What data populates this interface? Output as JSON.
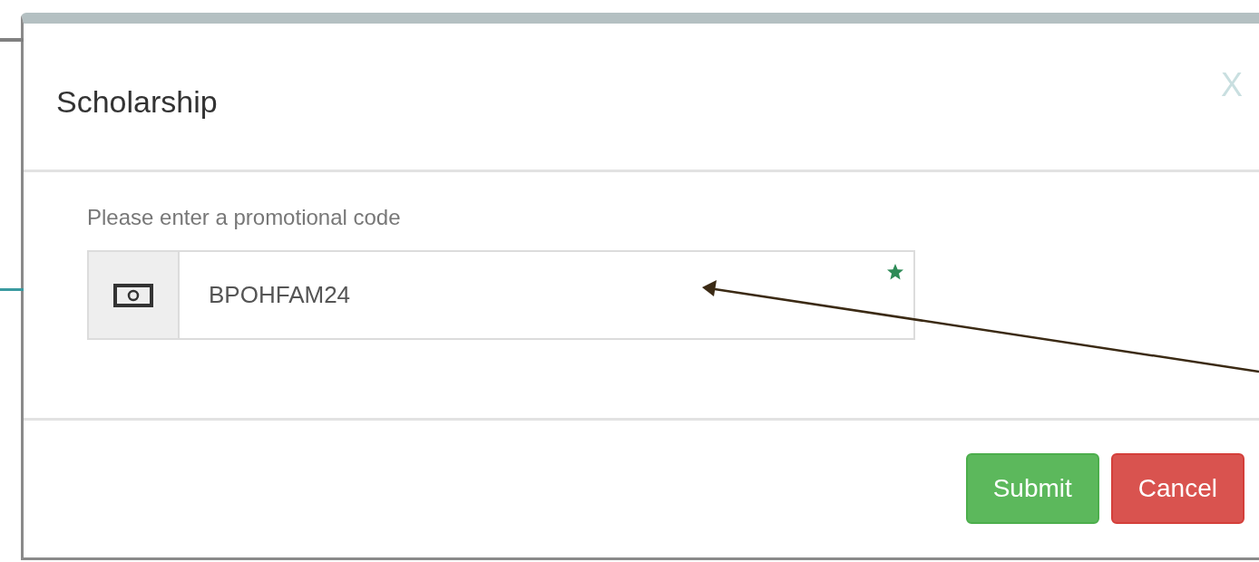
{
  "dialog": {
    "title": "Scholarship",
    "close": "X"
  },
  "form": {
    "label": "Please enter a promotional code",
    "field": {
      "value": "BPOHFAM24",
      "required": true
    }
  },
  "buttons": [
    {
      "label": "Submit",
      "kind": "success"
    },
    {
      "label": "Cancel",
      "kind": "danger"
    }
  ]
}
